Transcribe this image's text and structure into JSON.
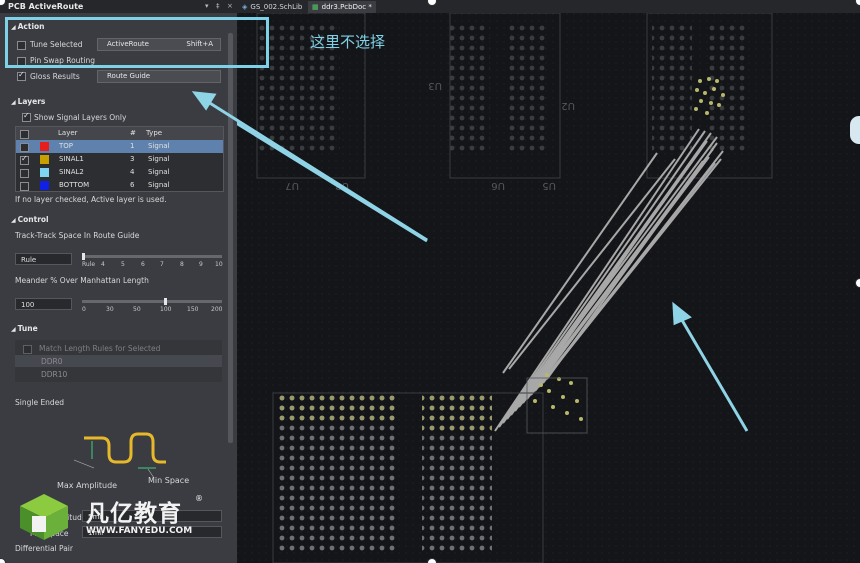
{
  "panel": {
    "title": "PCB ActiveRoute",
    "title_buttons": [
      "▾",
      "‡",
      "×"
    ],
    "action": {
      "heading": "Action",
      "tune_selected": {
        "label": "Tune Selected",
        "checked": false
      },
      "pin_swap": {
        "label": "Pin Swap Routing",
        "checked": false
      },
      "gloss": {
        "label": "Gloss Results",
        "checked": true
      },
      "activeroute_button": {
        "label": "ActiveRoute",
        "shortcut": "Shift+A"
      },
      "route_guide_button": {
        "label": "Route Guide"
      }
    },
    "layers": {
      "heading": "Layers",
      "show_signal_only": {
        "label": "Show Signal Layers Only",
        "checked": true
      },
      "columns": [
        "Layer",
        "#",
        "Type"
      ],
      "rows": [
        {
          "name": "TOP",
          "num": "1",
          "type": "Signal",
          "color": "#e81e1e",
          "checked": false,
          "selected": true
        },
        {
          "name": "SINAL1",
          "num": "3",
          "type": "Signal",
          "color": "#c8a000",
          "checked": true,
          "selected": false
        },
        {
          "name": "SINAL2",
          "num": "4",
          "type": "Signal",
          "color": "#7fd4f0",
          "checked": false,
          "selected": false
        },
        {
          "name": "BOTTOM",
          "num": "6",
          "type": "Signal",
          "color": "#1020e6",
          "checked": false,
          "selected": false
        }
      ],
      "note": "If no layer checked, Active layer is used."
    },
    "control": {
      "heading": "Control",
      "track_space_label": "Track-Track Space In Route Guide",
      "track_space_value": "Rule",
      "track_space_ticks": [
        "Rule",
        "4",
        "5",
        "6",
        "7",
        "8",
        "9",
        "10"
      ],
      "track_space_level": 0,
      "meander_label": "Meander % Over Manhattan Length",
      "meander_value": "100",
      "meander_ticks": [
        "0",
        "30",
        "50",
        "100",
        "150",
        "200"
      ],
      "meander_level": 100
    },
    "tune": {
      "heading": "Tune",
      "match_length": "Match Length Rules for Selected",
      "items": [
        "DDR0",
        "DDR10"
      ],
      "single_ended": "Single Ended",
      "max_amplitude": "Max Amplitude",
      "min_space": "Min Space",
      "amplitude_label": "Max Amplitude",
      "space_label": "Min Space",
      "amplitude_value": "5mil",
      "space_value": "1mil",
      "diff_pair": "Differential Pair"
    }
  },
  "tabs": [
    {
      "label": "GS_002.SchLib",
      "active": false
    },
    {
      "label": "ddr3.PcbDoc *",
      "active": true
    }
  ],
  "annotation": {
    "text": "这里不选择",
    "color": "#7ed1e6"
  },
  "silkscreen": [
    "U7",
    "U8",
    "U6",
    "U5",
    "U3",
    "U2"
  ],
  "watermark": {
    "name_cn": "凡亿教育",
    "reg": "®",
    "url": "WWW.FANYEDU.COM"
  }
}
